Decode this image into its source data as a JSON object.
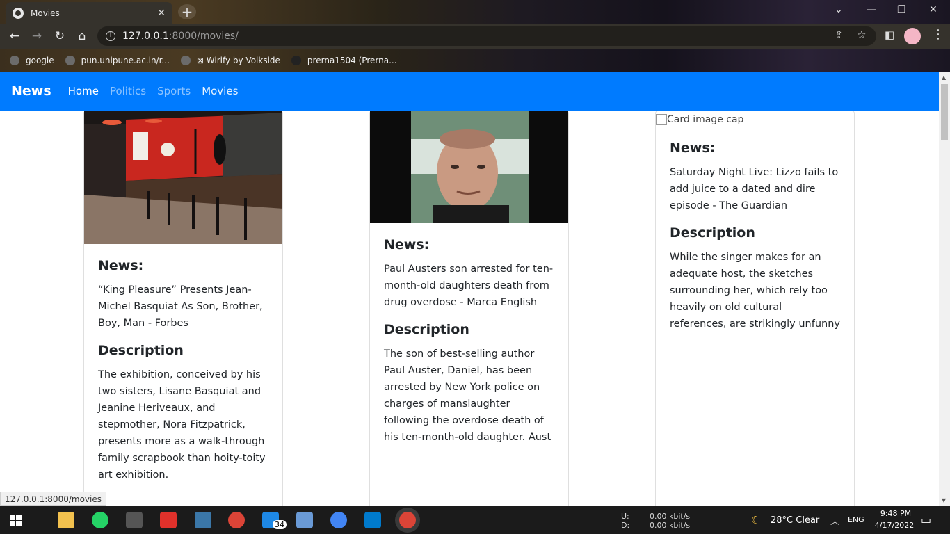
{
  "browser": {
    "tab_title": "Movies",
    "tab_close": "✕",
    "new_tab": "+",
    "url_host": "127.0.0.1",
    "url_path": ":8000/movies/",
    "bookmarks": [
      "google",
      "pun.unipune.ac.in/r...",
      "⊠ Wirify by Volkside",
      "prerna1504 (Prerna..."
    ]
  },
  "navbar": {
    "brand": "News",
    "links": [
      "Home",
      "Politics",
      "Sports",
      "Movies"
    ]
  },
  "cards": [
    {
      "news_heading": "News:",
      "news_text": "“King Pleasure” Presents Jean-Michel Basquiat As Son, Brother, Boy, Man - Forbes",
      "desc_heading": "Description",
      "desc_text": "The exhibition, conceived by his two sisters, Lisane Basquiat and Jeanine Heriveaux, and stepmother, Nora Fitzpatrick, presents more as a walk-through family scrapbook than hoity-toity art exhibition."
    },
    {
      "news_heading": "News:",
      "news_text": "Paul Austers son arrested for ten-month-old daughters death from drug overdose - Marca English",
      "desc_heading": "Description",
      "desc_text": "The son of best-selling author Paul Auster, Daniel, has been arrested by New York police on charges of manslaughter following the overdose death of his ten-month-old daughter. Aust"
    },
    {
      "img_alt": "Card image cap",
      "news_heading": "News:",
      "news_text": "Saturday Night Live: Lizzo fails to add juice to a dated and dire episode - The Guardian",
      "desc_heading": "Description",
      "desc_text": "While the singer makes for an adequate host, the sketches surrounding her, which rely too heavily on old cultural references, are strikingly unfunny"
    }
  ],
  "status_url": "127.0.0.1:8000/movies",
  "taskbar": {
    "mail_badge": "34",
    "net_up_label": "U:",
    "net_down_label": "D:",
    "net_up": "0.00 kbit/s",
    "net_down": "0.00 kbit/s",
    "weather": "28°C  Clear",
    "lang": "ENG",
    "time": "9:48 PM",
    "date": "4/17/2022"
  }
}
